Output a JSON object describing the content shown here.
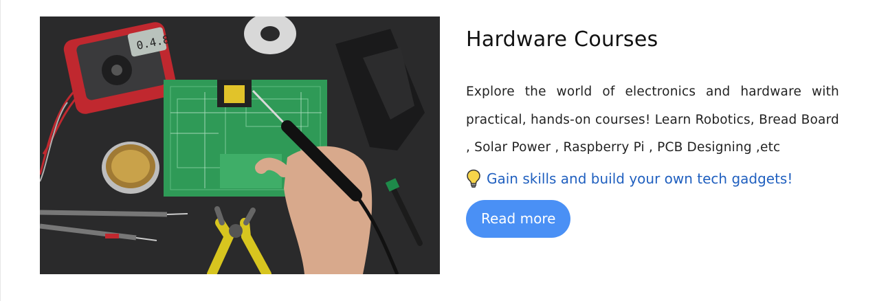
{
  "card": {
    "title": "Hardware Courses",
    "description": "Explore the world of electronics and hardware with practical, hands-on courses! Learn Robotics, Bread Board , Solar Power , Raspberry Pi , PCB Designing ,etc",
    "tip": {
      "icon": "lightbulb-icon",
      "text": "Gain skills and build your own tech gadgets!"
    },
    "button_label": "Read more",
    "image": {
      "multimeter_display": "0.4.8"
    }
  },
  "colors": {
    "accent": "#4a90f5",
    "tip_text": "#1f5fbf",
    "image_background": "#2b2b2c",
    "pcb_green": "#2f9a57"
  }
}
